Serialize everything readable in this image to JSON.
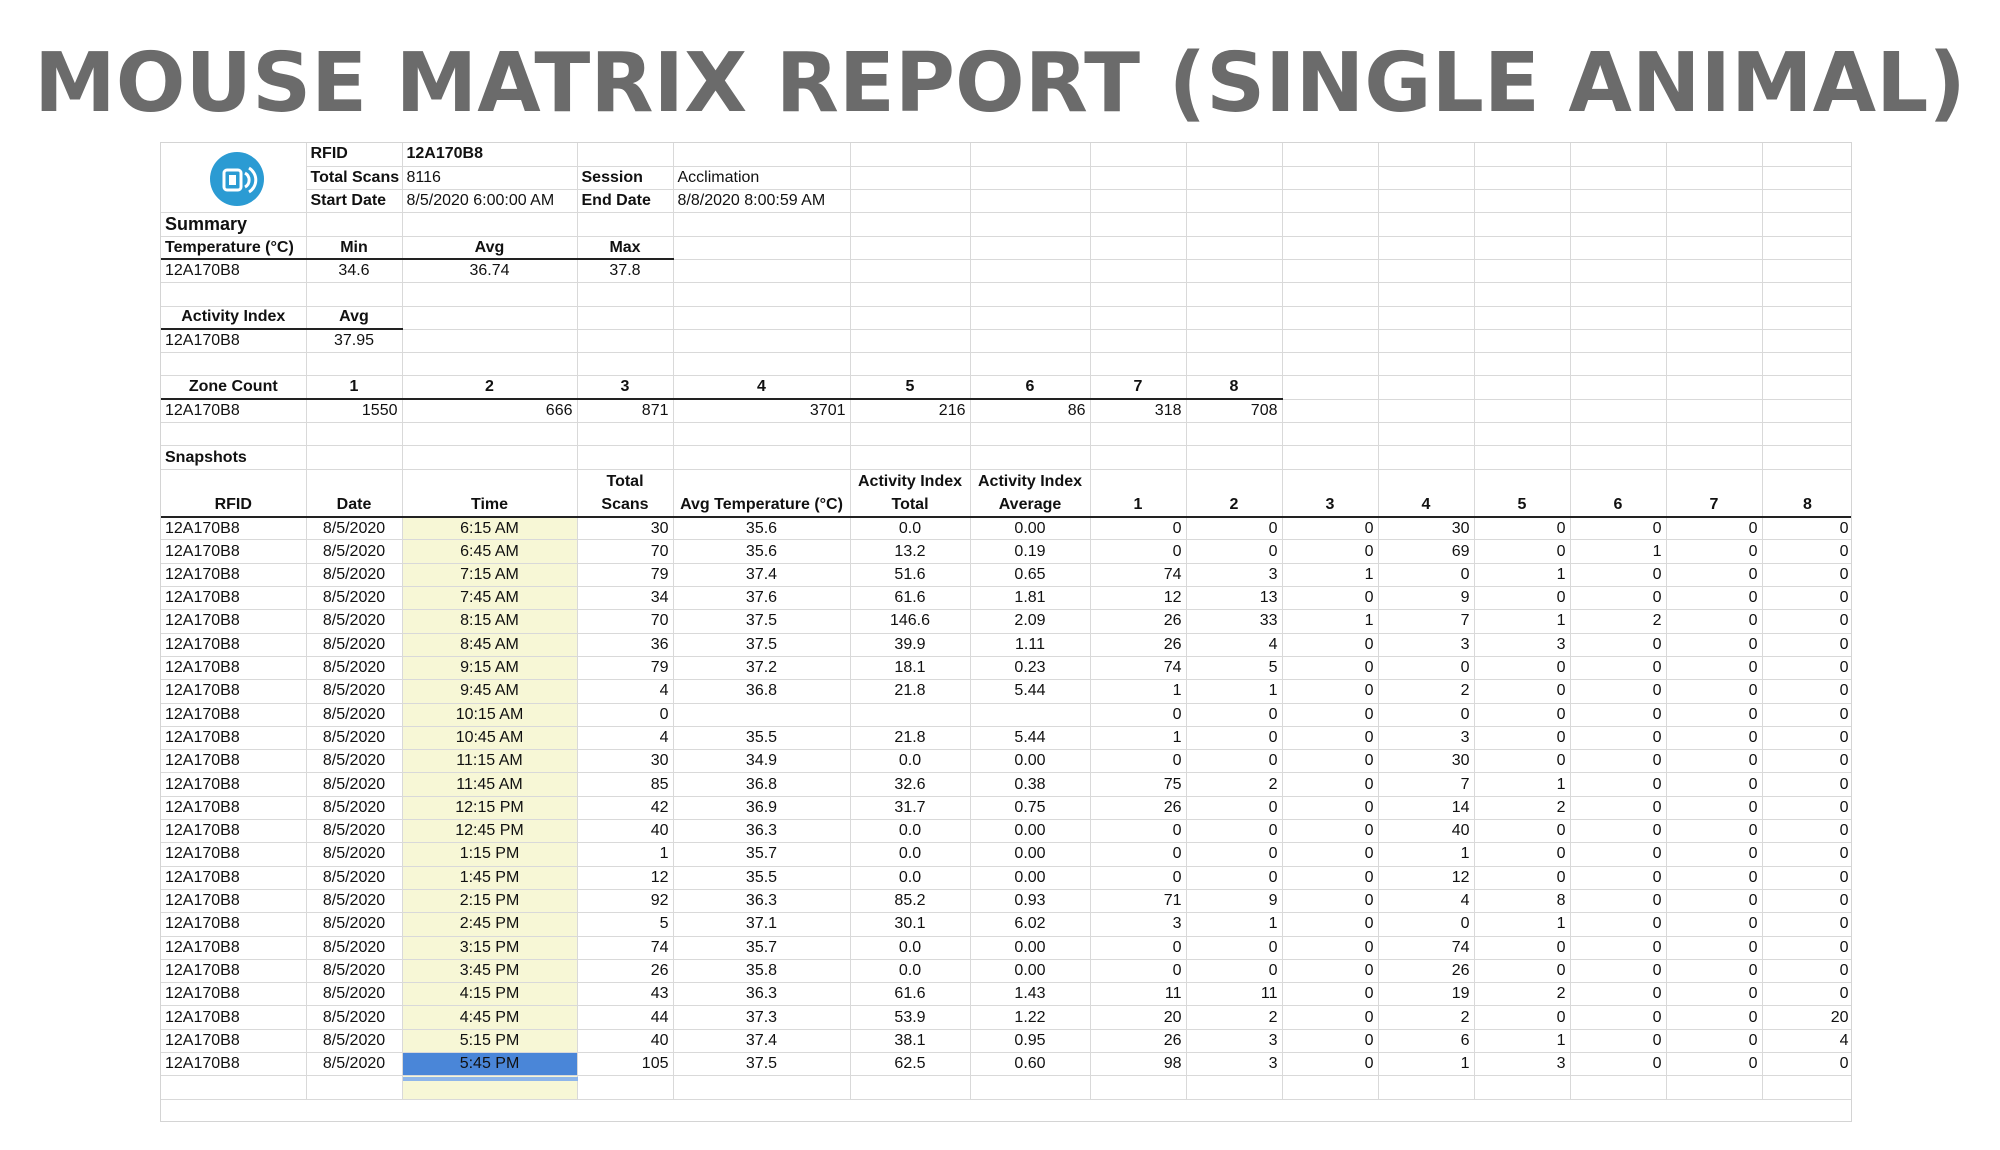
{
  "title": "MOUSE MATRIX REPORT (SINGLE ANIMAL)",
  "logo_icon": "rfid-chip-icon",
  "accent_color": "#2b9bd3",
  "info": {
    "rfid_label": "RFID",
    "rfid_value": "12A170B8",
    "total_scans_label": "Total Scans",
    "total_scans_value": "8116",
    "session_label": "Session",
    "session_value": "Acclimation",
    "start_date_label": "Start Date",
    "start_date_value": "8/5/2020 6:00:00 AM",
    "end_date_label": "End Date",
    "end_date_value": "8/8/2020 8:00:59 AM"
  },
  "summary": {
    "label": "Summary",
    "temperature": {
      "label": "Temperature (°C)",
      "min_label": "Min",
      "avg_label": "Avg",
      "max_label": "Max",
      "rfid": "12A170B8",
      "min": "34.6",
      "avg": "36.74",
      "max": "37.8"
    },
    "activity": {
      "label": "Activity Index",
      "avg_label": "Avg",
      "rfid": "12A170B8",
      "avg": "37.95"
    },
    "zone": {
      "label": "Zone Count",
      "headers": [
        "1",
        "2",
        "3",
        "4",
        "5",
        "6",
        "7",
        "8"
      ],
      "rfid": "12A170B8",
      "values": [
        "1550",
        "666",
        "871",
        "3701",
        "216",
        "86",
        "318",
        "708"
      ]
    }
  },
  "snapshots": {
    "label": "Snapshots",
    "headers": [
      "RFID",
      "Date",
      "Time",
      "Total Scans",
      "Avg Temperature (°C)",
      "Activity Index Total",
      "Activity Index Average",
      "1",
      "2",
      "3",
      "4",
      "5",
      "6",
      "7",
      "8"
    ],
    "rows": [
      [
        "12A170B8",
        "8/5/2020",
        "6:15 AM",
        "30",
        "35.6",
        "0.0",
        "0.00",
        "0",
        "0",
        "0",
        "30",
        "0",
        "0",
        "0",
        "0"
      ],
      [
        "12A170B8",
        "8/5/2020",
        "6:45 AM",
        "70",
        "35.6",
        "13.2",
        "0.19",
        "0",
        "0",
        "0",
        "69",
        "0",
        "1",
        "0",
        "0"
      ],
      [
        "12A170B8",
        "8/5/2020",
        "7:15 AM",
        "79",
        "37.4",
        "51.6",
        "0.65",
        "74",
        "3",
        "1",
        "0",
        "1",
        "0",
        "0",
        "0"
      ],
      [
        "12A170B8",
        "8/5/2020",
        "7:45 AM",
        "34",
        "37.6",
        "61.6",
        "1.81",
        "12",
        "13",
        "0",
        "9",
        "0",
        "0",
        "0",
        "0"
      ],
      [
        "12A170B8",
        "8/5/2020",
        "8:15 AM",
        "70",
        "37.5",
        "146.6",
        "2.09",
        "26",
        "33",
        "1",
        "7",
        "1",
        "2",
        "0",
        "0"
      ],
      [
        "12A170B8",
        "8/5/2020",
        "8:45 AM",
        "36",
        "37.5",
        "39.9",
        "1.11",
        "26",
        "4",
        "0",
        "3",
        "3",
        "0",
        "0",
        "0"
      ],
      [
        "12A170B8",
        "8/5/2020",
        "9:15 AM",
        "79",
        "37.2",
        "18.1",
        "0.23",
        "74",
        "5",
        "0",
        "0",
        "0",
        "0",
        "0",
        "0"
      ],
      [
        "12A170B8",
        "8/5/2020",
        "9:45 AM",
        "4",
        "36.8",
        "21.8",
        "5.44",
        "1",
        "1",
        "0",
        "2",
        "0",
        "0",
        "0",
        "0"
      ],
      [
        "12A170B8",
        "8/5/2020",
        "10:15 AM",
        "0",
        "",
        "",
        "",
        "0",
        "0",
        "0",
        "0",
        "0",
        "0",
        "0",
        "0"
      ],
      [
        "12A170B8",
        "8/5/2020",
        "10:45 AM",
        "4",
        "35.5",
        "21.8",
        "5.44",
        "1",
        "0",
        "0",
        "3",
        "0",
        "0",
        "0",
        "0"
      ],
      [
        "12A170B8",
        "8/5/2020",
        "11:15 AM",
        "30",
        "34.9",
        "0.0",
        "0.00",
        "0",
        "0",
        "0",
        "30",
        "0",
        "0",
        "0",
        "0"
      ],
      [
        "12A170B8",
        "8/5/2020",
        "11:45 AM",
        "85",
        "36.8",
        "32.6",
        "0.38",
        "75",
        "2",
        "0",
        "7",
        "1",
        "0",
        "0",
        "0"
      ],
      [
        "12A170B8",
        "8/5/2020",
        "12:15 PM",
        "42",
        "36.9",
        "31.7",
        "0.75",
        "26",
        "0",
        "0",
        "14",
        "2",
        "0",
        "0",
        "0"
      ],
      [
        "12A170B8",
        "8/5/2020",
        "12:45 PM",
        "40",
        "36.3",
        "0.0",
        "0.00",
        "0",
        "0",
        "0",
        "40",
        "0",
        "0",
        "0",
        "0"
      ],
      [
        "12A170B8",
        "8/5/2020",
        "1:15 PM",
        "1",
        "35.7",
        "0.0",
        "0.00",
        "0",
        "0",
        "0",
        "1",
        "0",
        "0",
        "0",
        "0"
      ],
      [
        "12A170B8",
        "8/5/2020",
        "1:45 PM",
        "12",
        "35.5",
        "0.0",
        "0.00",
        "0",
        "0",
        "0",
        "12",
        "0",
        "0",
        "0",
        "0"
      ],
      [
        "12A170B8",
        "8/5/2020",
        "2:15 PM",
        "92",
        "36.3",
        "85.2",
        "0.93",
        "71",
        "9",
        "0",
        "4",
        "8",
        "0",
        "0",
        "0"
      ],
      [
        "12A170B8",
        "8/5/2020",
        "2:45 PM",
        "5",
        "37.1",
        "30.1",
        "6.02",
        "3",
        "1",
        "0",
        "0",
        "1",
        "0",
        "0",
        "0"
      ],
      [
        "12A170B8",
        "8/5/2020",
        "3:15 PM",
        "74",
        "35.7",
        "0.0",
        "0.00",
        "0",
        "0",
        "0",
        "74",
        "0",
        "0",
        "0",
        "0"
      ],
      [
        "12A170B8",
        "8/5/2020",
        "3:45 PM",
        "26",
        "35.8",
        "0.0",
        "0.00",
        "0",
        "0",
        "0",
        "26",
        "0",
        "0",
        "0",
        "0"
      ],
      [
        "12A170B8",
        "8/5/2020",
        "4:15 PM",
        "43",
        "36.3",
        "61.6",
        "1.43",
        "11",
        "11",
        "0",
        "19",
        "2",
        "0",
        "0",
        "0"
      ],
      [
        "12A170B8",
        "8/5/2020",
        "4:45 PM",
        "44",
        "37.3",
        "53.9",
        "1.22",
        "20",
        "2",
        "0",
        "2",
        "0",
        "0",
        "0",
        "20"
      ],
      [
        "12A170B8",
        "8/5/2020",
        "5:15 PM",
        "40",
        "37.4",
        "38.1",
        "0.95",
        "26",
        "3",
        "0",
        "6",
        "1",
        "0",
        "0",
        "4"
      ],
      [
        "12A170B8",
        "8/5/2020",
        "5:45 PM",
        "105",
        "37.5",
        "62.5",
        "0.60",
        "98",
        "3",
        "0",
        "1",
        "3",
        "0",
        "0",
        "0"
      ]
    ]
  }
}
